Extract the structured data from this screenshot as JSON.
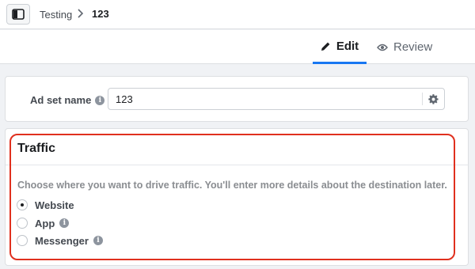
{
  "breadcrumb": {
    "parent": "Testing",
    "separator": ">",
    "current": "123"
  },
  "tabs": [
    {
      "label": "Edit",
      "icon": "pencil-icon",
      "active": true
    },
    {
      "label": "Review",
      "icon": "eye-icon",
      "active": false
    }
  ],
  "ad_set": {
    "label": "Ad set name",
    "value": "123",
    "info_icon": "info-icon",
    "settings_icon": "gear-icon"
  },
  "traffic": {
    "title": "Traffic",
    "description": "Choose where you want to drive traffic. You'll enter more details about the destination later.",
    "options": [
      {
        "label": "Website",
        "selected": true,
        "info": false
      },
      {
        "label": "App",
        "selected": false,
        "info": true
      },
      {
        "label": "Messenger",
        "selected": false,
        "info": true
      }
    ]
  },
  "colors": {
    "accent": "#1877f2",
    "highlight": "#e0301e",
    "background": "#f0f2f5"
  }
}
